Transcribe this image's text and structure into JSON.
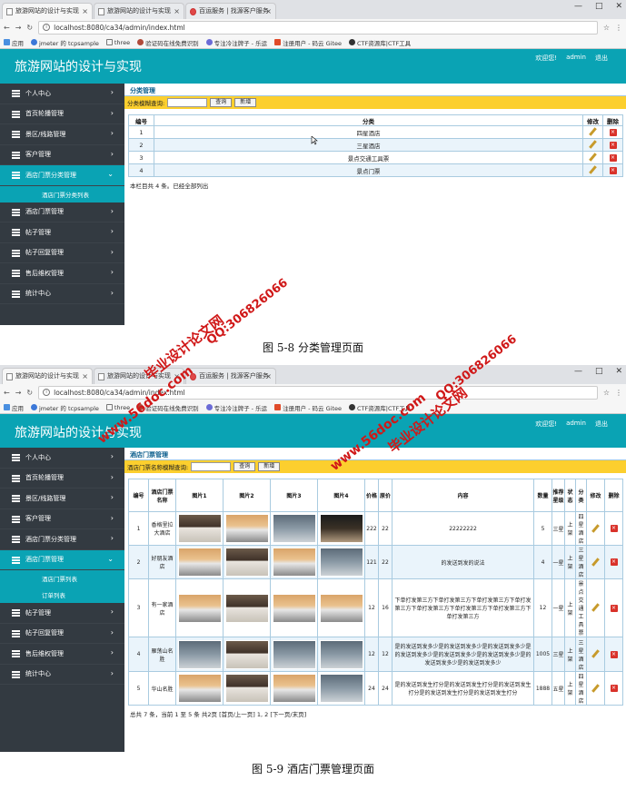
{
  "browser": {
    "tabs": [
      "旅游网站的设计与实现",
      "旅游网站的设计与实现",
      "百运服务 | 找源客户服务"
    ],
    "url": "localhost:8080/ca34/admin/index.html",
    "url2": "localhost:8080/ca34/admin/index.html",
    "bookmarks": [
      "应用",
      "jmeter 的 tcpsample",
      "three",
      "验证码在线免费识别",
      "专注冷注牌子 - 乐运",
      "注册用户 - 码云 Gitee",
      "CTF资源库|CTF工具"
    ]
  },
  "app": {
    "title": "旅游网站的设计与实现",
    "welcome": "欢迎您!",
    "user": "admin",
    "logout": "退出"
  },
  "sidebar1": {
    "items": [
      "个人中心",
      "首页轮播管理",
      "景区/线路管理",
      "客户管理",
      "酒店门票分类管理",
      "酒店门票管理",
      "帖子管理",
      "帖子回复管理",
      "售后维权管理",
      "统计中心"
    ],
    "sub": [
      "酒店门票分类列表"
    ]
  },
  "sidebar2": {
    "items": [
      "个人中心",
      "首页轮播管理",
      "景区/线路管理",
      "客户管理",
      "酒店门票分类管理",
      "酒店门票管理",
      "帖子管理",
      "帖子回复管理",
      "售后维权管理",
      "统计中心"
    ],
    "sub": [
      "酒店门票列表",
      "订单列表"
    ]
  },
  "page1": {
    "crumb": "分类管理",
    "search_label": "分类模糊查询:",
    "query_btn": "查询",
    "add_btn": "新增",
    "headers": [
      "编号",
      "分类",
      "修改",
      "删除"
    ],
    "rows": [
      {
        "id": "1",
        "name": "四星酒店"
      },
      {
        "id": "2",
        "name": "三星酒店"
      },
      {
        "id": "3",
        "name": "景点交通工具票"
      },
      {
        "id": "4",
        "name": "景点门票"
      }
    ],
    "footer": "本栏目共 4 条。已经全部列出"
  },
  "caption1": "图 5-8 分类管理页面",
  "page2": {
    "crumb": "酒店门票管理",
    "search_label": "酒店门票名称模糊查询:",
    "query_btn": "查询",
    "add_btn": "新增",
    "headers": [
      "编号",
      "酒店门票名称",
      "图片1",
      "图片2",
      "图片3",
      "图片4",
      "价格",
      "原价",
      "内容",
      "数量",
      "推荐星级",
      "状态",
      "分类",
      "修改",
      "删除"
    ],
    "rows": [
      {
        "id": "1",
        "name": "香格里拉大酒店",
        "price": "222",
        "orig": "22",
        "content": "22222222",
        "qty": "5",
        "star": "三星",
        "status": "上架",
        "cat": "四星酒店"
      },
      {
        "id": "2",
        "name": "好朋友酒店",
        "price": "121",
        "orig": "22",
        "content": "的发送到发的说法",
        "qty": "4",
        "star": "一星",
        "status": "上架",
        "cat": "三星酒店"
      },
      {
        "id": "3",
        "name": "有一家酒店",
        "price": "12",
        "orig": "16",
        "content": "下单打发第三方下单打发第三方下单打发第三方下单打发第三方下单打发第三方下单打发第三方下单打发第三方下单打发第三方",
        "qty": "12",
        "star": "一星",
        "status": "上架",
        "cat": "景点交通工具票"
      },
      {
        "id": "4",
        "name": "雁荡山名胜",
        "price": "12",
        "orig": "12",
        "content": "是的发送到发多少是的发送到发多少是的发送到发多少是的发送到发多少是的发送到发多少是的发送到发多少是的发送到发多少是的发送到发多少",
        "qty": "1005",
        "star": "三星",
        "status": "上架",
        "cat": "三星酒店"
      },
      {
        "id": "5",
        "name": "华山名胜",
        "price": "24",
        "orig": "24",
        "content": "是的发送到发生打分是的发送到发生打分是的发送到发生打分是的发送到发生打分是的发送到发生打分",
        "qty": "1888",
        "star": "五星",
        "status": "上架",
        "cat": "四星酒店"
      }
    ],
    "footer": "总共 7 条，当前 1 至 5 条 共2页 [首页/上一页] 1, 2 [下一页/末页]"
  },
  "caption2": "图 5-9 酒店门票管理页面",
  "watermarks": [
    "毕业设计论文网",
    "www.56doc.com",
    "QQ:306826066"
  ],
  "colors": {
    "teal": "#0aa3b4",
    "sidebar": "#333a41",
    "yellow": "#fccf2e"
  }
}
